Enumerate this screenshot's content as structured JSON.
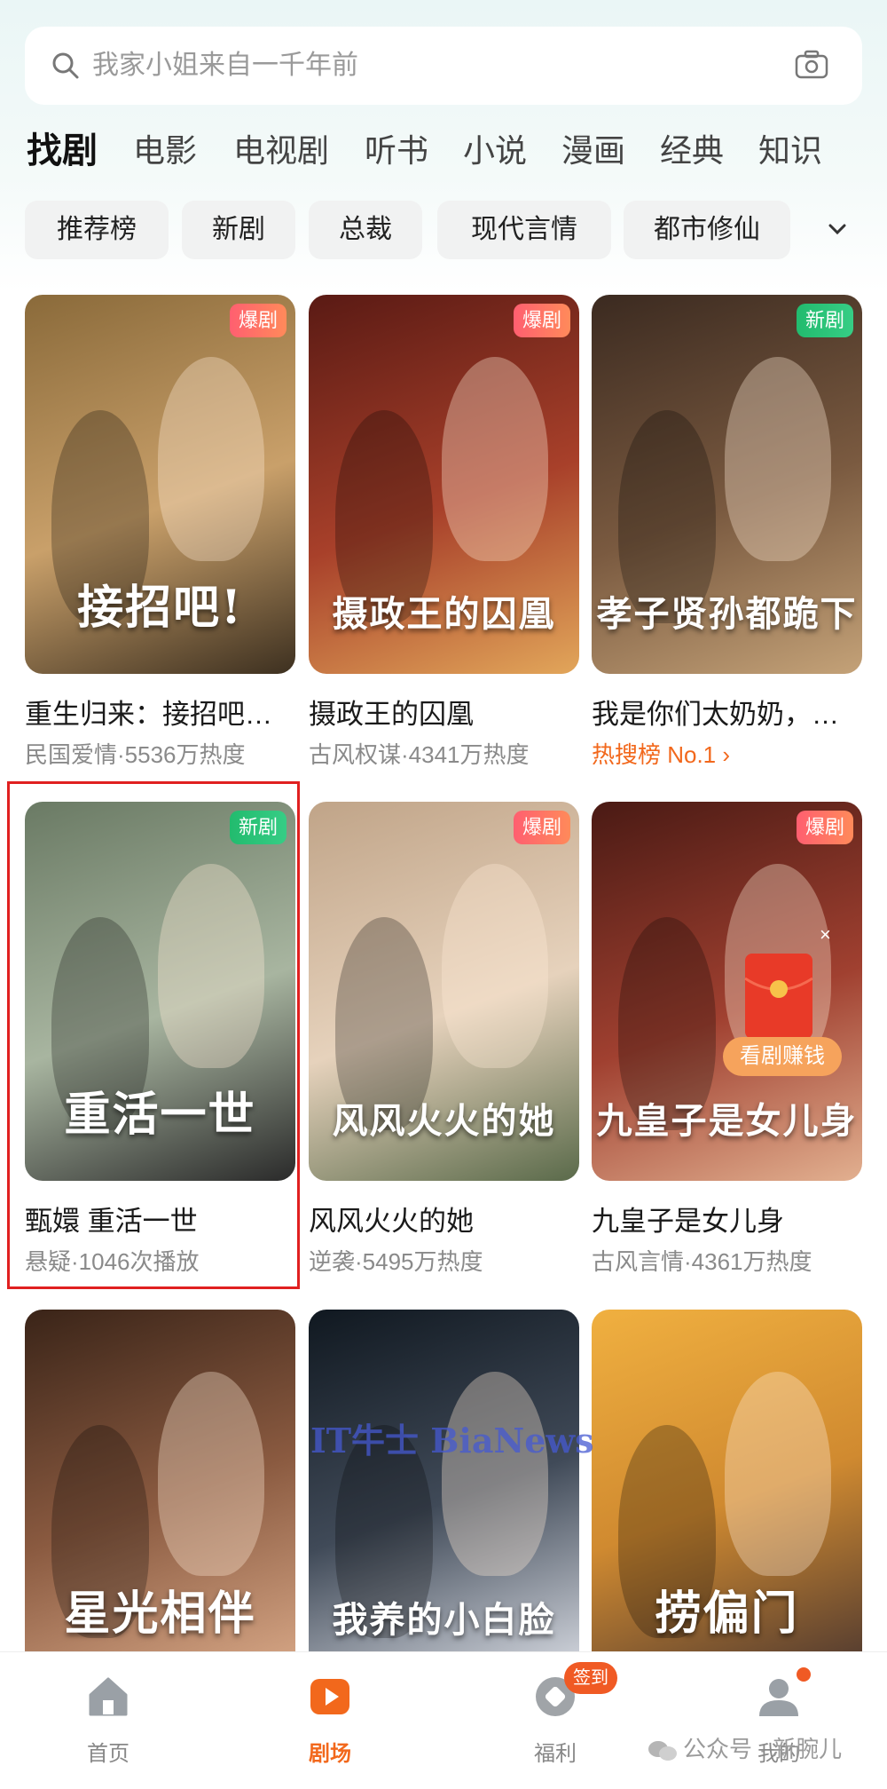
{
  "search": {
    "placeholder": "我家小姐来自一千年前"
  },
  "tabs": [
    "找剧",
    "电影",
    "电视剧",
    "听书",
    "小说",
    "漫画",
    "经典",
    "知识"
  ],
  "chips": [
    "推荐榜",
    "新剧",
    "总裁",
    "现代言情",
    "都市修仙"
  ],
  "cards": [
    {
      "badge": "爆剧",
      "badge_type": "hot",
      "poster_text": "接招吧!",
      "title": "重生归来：接招吧…",
      "subtitle": "民国爱情·5536万热度",
      "colors": [
        "#8a6a3a",
        "#c9a06a",
        "#3d3020"
      ]
    },
    {
      "badge": "爆剧",
      "badge_type": "hot",
      "poster_text": "摄政王的囚凰",
      "title": "摄政王的囚凰",
      "subtitle": "古风权谋·4341万热度",
      "colors": [
        "#5a1a14",
        "#a8402a",
        "#e2a65a"
      ]
    },
    {
      "badge": "新剧",
      "badge_type": "new",
      "poster_text": "孝子贤孙都跪下",
      "title": "我是你们太奶奶，…",
      "subtitle": "热搜榜 No.1 ›",
      "subtitle_rank": true,
      "colors": [
        "#3b2a20",
        "#7a5a40",
        "#c4a278"
      ]
    },
    {
      "badge": "新剧",
      "badge_type": "new",
      "poster_text": "重活一世",
      "title": "甄嬛 重活一世",
      "subtitle": "悬疑·1046次播放",
      "colors": [
        "#6a7a64",
        "#a8b5a0",
        "#2a2a2a"
      ]
    },
    {
      "badge": "爆剧",
      "badge_type": "hot",
      "poster_text": "风风火火的她",
      "title": "风风火火的她",
      "subtitle": "逆袭·5495万热度",
      "colors": [
        "#c0a488",
        "#e6d2bc",
        "#5a6a4a"
      ]
    },
    {
      "badge": "爆剧",
      "badge_type": "hot",
      "poster_text": "九皇子是女儿身",
      "title": "九皇子是女儿身",
      "subtitle": "古风言情·4361万热度",
      "colors": [
        "#4a1a14",
        "#a04030",
        "#e2b090"
      ]
    },
    {
      "badge": "",
      "badge_type": "none",
      "poster_text": "星光相伴",
      "title": "",
      "subtitle": "",
      "colors": [
        "#3a2418",
        "#8a5a40",
        "#d0a080"
      ]
    },
    {
      "badge": "",
      "badge_type": "none",
      "poster_text": "我养的小白脸",
      "title": "",
      "subtitle": "",
      "colors": [
        "#101820",
        "#404a58",
        "#c8ccd4"
      ]
    },
    {
      "badge": "",
      "badge_type": "none",
      "poster_text": "捞偏门",
      "title": "",
      "subtitle": "",
      "colors": [
        "#f0b040",
        "#d08a30",
        "#5a4030"
      ]
    }
  ],
  "floating": {
    "pill": "看剧赚钱",
    "close": "×"
  },
  "watermark": "IT牛士 BiaNews",
  "nav": [
    "首页",
    "剧场",
    "福利",
    "我的"
  ],
  "sign_badge": "签到",
  "account": "公众号 · 新腕儿"
}
